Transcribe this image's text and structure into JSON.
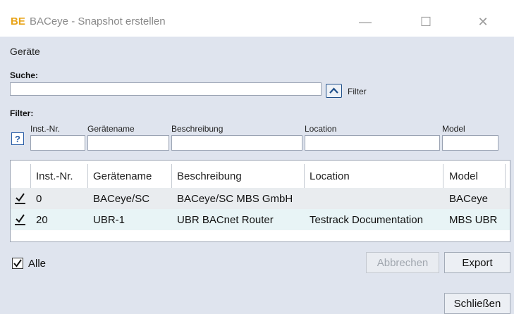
{
  "window": {
    "logo": "BE",
    "title": "BACeye - Snapshot erstellen",
    "minimize_glyph": "—",
    "maximize_glyph": "☐",
    "close_glyph": "✕"
  },
  "devices_heading": "Geräte",
  "search": {
    "label": "Suche:",
    "value": "",
    "placeholder": "",
    "filter_toggle_icon": "chevron-up-icon",
    "filter_label": "Filter"
  },
  "filter": {
    "label": "Filter:",
    "help_glyph": "?",
    "columns": [
      "Inst.-Nr.",
      "Gerätename",
      "Beschreibung",
      "Location",
      "Model"
    ]
  },
  "table": {
    "headers": [
      "Inst.-Nr.",
      "Gerätename",
      "Beschreibung",
      "Location",
      "Model"
    ],
    "rows": [
      {
        "checked": true,
        "inst": "0",
        "name": "BACeye/SC",
        "description": "BACeye/SC MBS GmbH",
        "location": "",
        "model": "BACeye"
      },
      {
        "checked": true,
        "inst": "20",
        "name": "UBR-1",
        "description": "UBR BACnet Router",
        "location": "Testrack Documentation",
        "model": "MBS UBR"
      }
    ]
  },
  "select_all": {
    "label": "Alle",
    "checked": true
  },
  "buttons": {
    "cancel": "Abbrechen",
    "export": "Export",
    "close": "Schließen"
  },
  "colors": {
    "accent": "#e8a317",
    "panel": "#dfe4ee",
    "row_selected": "#e8f4f6"
  }
}
